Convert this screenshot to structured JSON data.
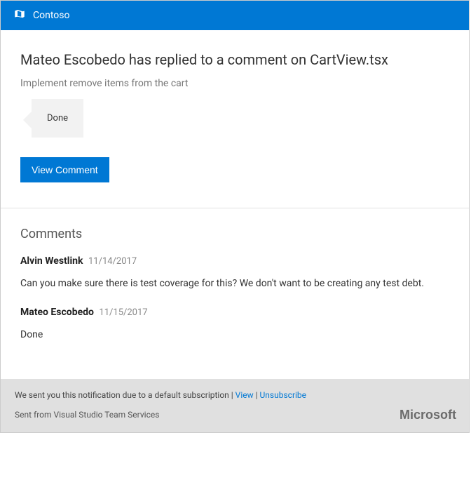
{
  "header": {
    "org": "Contoso"
  },
  "main": {
    "title": "Mateo Escobedo has replied to a comment on CartView.tsx",
    "subtitle": "Implement remove items from the cart",
    "bubble_text": "Done",
    "view_button": "View Comment"
  },
  "comments": {
    "heading": "Comments",
    "items": [
      {
        "author": "Alvin Westlink",
        "date": "11/14/2017",
        "body": "Can you make sure there is test coverage for this? We don't want to be creating any test debt."
      },
      {
        "author": "Mateo Escobedo",
        "date": "11/15/2017",
        "body": "Done"
      }
    ]
  },
  "footer": {
    "notice_prefix": "We sent you this notification due to a default subscription | ",
    "view_link": "View",
    "separator": " | ",
    "unsubscribe_link": "Unsubscribe",
    "sent_from": "Sent from Visual Studio Team Services",
    "brand": "Microsoft"
  }
}
